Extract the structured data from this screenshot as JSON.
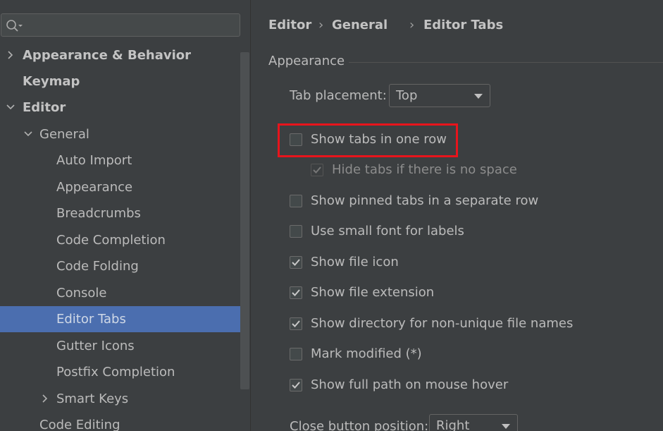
{
  "search": {
    "placeholder": "",
    "value": ""
  },
  "sidebar": {
    "items": [
      {
        "label": "Appearance & Behavior",
        "chevron": "right",
        "bold": true
      },
      {
        "label": "Keymap",
        "chevron": "",
        "bold": true
      },
      {
        "label": "Editor",
        "chevron": "down",
        "bold": true
      },
      {
        "label": "General",
        "chevron": "down",
        "bold": false
      },
      {
        "label": "Auto Import"
      },
      {
        "label": "Appearance"
      },
      {
        "label": "Breadcrumbs"
      },
      {
        "label": "Code Completion"
      },
      {
        "label": "Code Folding"
      },
      {
        "label": "Console"
      },
      {
        "label": "Editor Tabs",
        "selected": true
      },
      {
        "label": "Gutter Icons"
      },
      {
        "label": "Postfix Completion"
      },
      {
        "label": "Smart Keys",
        "chevron": "right"
      },
      {
        "label": "Code Editing"
      }
    ]
  },
  "breadcrumb": {
    "items": [
      "Editor",
      "General",
      "Editor Tabs"
    ],
    "separator": "›"
  },
  "appearance_group": {
    "title": "Appearance"
  },
  "tab_placement": {
    "label": "Tab placement:",
    "value": "Top"
  },
  "options": [
    {
      "label": "Show tabs in one row",
      "checked": false,
      "enabled": true,
      "highlighted": true
    },
    {
      "label": "Hide tabs if there is no space",
      "checked": true,
      "enabled": false
    },
    {
      "label": "Show pinned tabs in a separate row",
      "checked": false,
      "enabled": true
    },
    {
      "label": "Use small font for labels",
      "checked": false,
      "enabled": true
    },
    {
      "label": "Show file icon",
      "checked": true,
      "enabled": true
    },
    {
      "label": "Show file extension",
      "checked": true,
      "enabled": true
    },
    {
      "label": "Show directory for non-unique file names",
      "checked": true,
      "enabled": true
    },
    {
      "label": "Mark modified (*)",
      "checked": false,
      "enabled": true
    },
    {
      "label": "Show full path on mouse hover",
      "checked": true,
      "enabled": true
    }
  ],
  "close_button_position": {
    "label": "Close button position:",
    "value": "Right"
  },
  "colors": {
    "selection": "#4b6eaf",
    "highlight_box": "#e8141c",
    "background": "#3c3f41"
  }
}
